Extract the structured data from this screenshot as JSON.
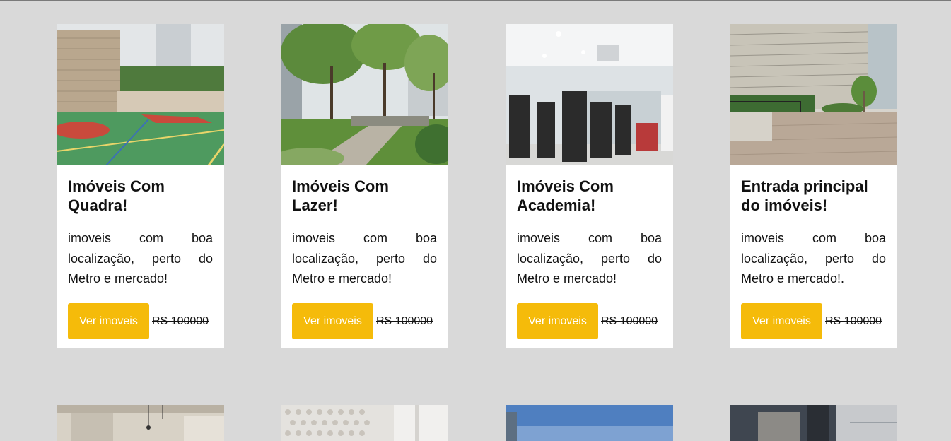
{
  "cards": [
    {
      "title": "Imóveis Com Quadra!",
      "text": "imoveis com boa localização, perto do Metro e mercado!",
      "button_label": "Ver imoveis",
      "price": "RS 100000",
      "image": "sports-court-photo"
    },
    {
      "title": "Imóveis Com Lazer!",
      "text": "imoveis com boa localização, perto do Metro e mercado!",
      "button_label": "Ver imoveis",
      "price": "RS 100000",
      "image": "garden-photo"
    },
    {
      "title": "Imóveis Com Academia!",
      "text": "imoveis com boa localização, perto do Metro e mercado!",
      "button_label": "Ver imoveis",
      "price": "RS 100000",
      "image": "gym-photo"
    },
    {
      "title": "Entrada principal do imóveis!",
      "text": "imoveis com boa localização, perto do Metro e mercado!.",
      "button_label": "Ver imoveis",
      "price": "RS 100000",
      "image": "building-entrance-photo"
    }
  ],
  "colors": {
    "background": "#d9d9d9",
    "card": "#ffffff",
    "button": "#f5bb0a",
    "button_text": "#ffffff"
  }
}
